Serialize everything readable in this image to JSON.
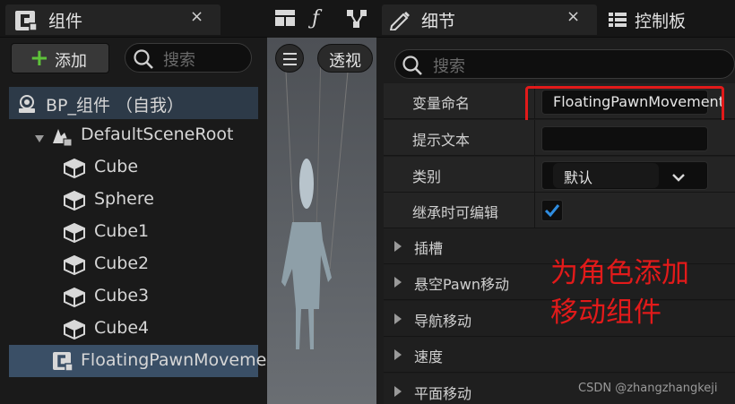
{
  "components_panel": {
    "tab_title": "组件",
    "close_glyph": "×",
    "add_label": "添加",
    "search_placeholder": "搜索",
    "tree": [
      {
        "label": "BP_组件 （自我）",
        "icon": "blueprint-self-icon"
      },
      {
        "label": "DefaultSceneRoot",
        "icon": "scene-root-icon"
      },
      {
        "label": "Cube",
        "icon": "cube-icon"
      },
      {
        "label": "Sphere",
        "icon": "cube-icon"
      },
      {
        "label": "Cube1",
        "icon": "cube-icon"
      },
      {
        "label": "Cube2",
        "icon": "cube-icon"
      },
      {
        "label": "Cube3",
        "icon": "cube-icon"
      },
      {
        "label": "Cube4",
        "icon": "cube-icon"
      },
      {
        "label": "FloatingPawnMoveme",
        "icon": "component-c-icon"
      }
    ]
  },
  "viewport": {
    "perspective_label": "透视"
  },
  "details_panel": {
    "tab_title": "细节",
    "close_glyph": "×",
    "control_tab_title": "控制板",
    "search_placeholder": "搜索",
    "properties": {
      "variable_name": {
        "label": "变量命名",
        "value": "FloatingPawnMovement"
      },
      "tooltip": {
        "label": "提示文本",
        "value": ""
      },
      "category": {
        "label": "类别",
        "value": "默认"
      },
      "editable_inherit": {
        "label": "继承时可编辑",
        "checked": true
      }
    },
    "sections": [
      "插槽",
      "悬空Pawn移动",
      "导航移动",
      "速度",
      "平面移动"
    ]
  },
  "annotation": {
    "line1": "为角色添加",
    "line2": "移动组件",
    "color": "#e21a1a"
  },
  "watermark": "CSDN @zhangzhangkeji",
  "colors": {
    "selected_row": "#3a4f66",
    "root_row": "#2d3a48",
    "add_plus": "#5ec23a",
    "checkbox_check": "#2f8de0"
  }
}
